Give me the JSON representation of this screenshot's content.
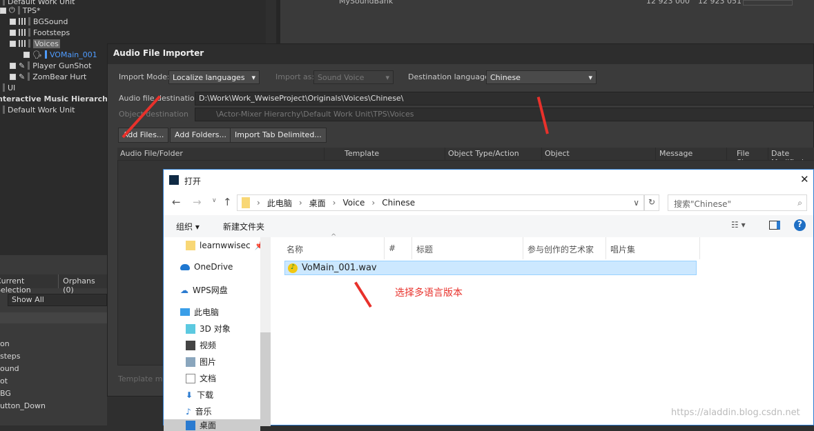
{
  "tree": {
    "items": [
      {
        "label": "Default Work Unit"
      },
      {
        "label": "TPS*"
      },
      {
        "label": "BGSound"
      },
      {
        "label": "Footsteps"
      },
      {
        "label": "Voices"
      },
      {
        "label": "VOMain_001"
      },
      {
        "label": "Player GunShot"
      },
      {
        "label": "ZomBear Hurt"
      },
      {
        "label": "UI"
      },
      {
        "label": "Interactive Music Hierarchy"
      },
      {
        "label": "Default Work Unit"
      }
    ]
  },
  "soundbank": {
    "name": "MySoundBank",
    "value1": "12 923 000",
    "value2": "12 923 051"
  },
  "lower_panel": {
    "tabs": [
      "Current Selection",
      "Orphans (0)"
    ],
    "filter": "Show All",
    "items": [
      "on",
      "steps",
      "ound",
      "ot",
      "BG",
      "utton_Down"
    ]
  },
  "importer": {
    "title": "Audio File Importer",
    "import_mode_label": "Import Mode:",
    "import_mode": "Localize languages",
    "import_as_label": "Import as:",
    "import_as": "Sound Voice",
    "dest_lang_label": "Destination language:",
    "dest_lang": "Chinese",
    "audio_dest_label": "Audio file destination",
    "audio_dest": "D:\\Work\\Work_WwiseProject\\Originals\\Voices\\Chinese\\",
    "object_dest_label": "Object destination",
    "object_dest": "\\Actor-Mixer Hierarchy\\Default Work Unit\\TPS\\Voices",
    "buttons": [
      "Add Files...",
      "Add Folders...",
      "Import Tab Delimited..."
    ],
    "columns": [
      "Audio File/Folder",
      "Template",
      "Object Type/Action",
      "Object",
      "Message",
      "File Size",
      "Date Modified"
    ],
    "footer": "Template mat"
  },
  "open_dialog": {
    "title": "打开",
    "breadcrumb": [
      "此电脑",
      "桌面",
      "Voice",
      "Chinese"
    ],
    "search_placeholder": "搜索\"Chinese\"",
    "organize": "组织",
    "new_folder": "新建文件夹",
    "nav": [
      "learnwwisec",
      "OneDrive",
      "WPS网盘",
      "此电脑",
      "3D 对象",
      "视频",
      "图片",
      "文档",
      "下载",
      "音乐",
      "桌面"
    ],
    "columns": [
      "名称",
      "#",
      "标题",
      "参与创作的艺术家",
      "唱片集"
    ],
    "files": [
      {
        "name": "VoMain_001.wav",
        "selected": true
      }
    ]
  },
  "annotation": "选择多语言版本",
  "watermark": "https://aladdin.blog.csdn.net",
  "colors": {
    "accent": "#e8312b",
    "selection": "#cce8ff",
    "link": "#4f9cff"
  }
}
